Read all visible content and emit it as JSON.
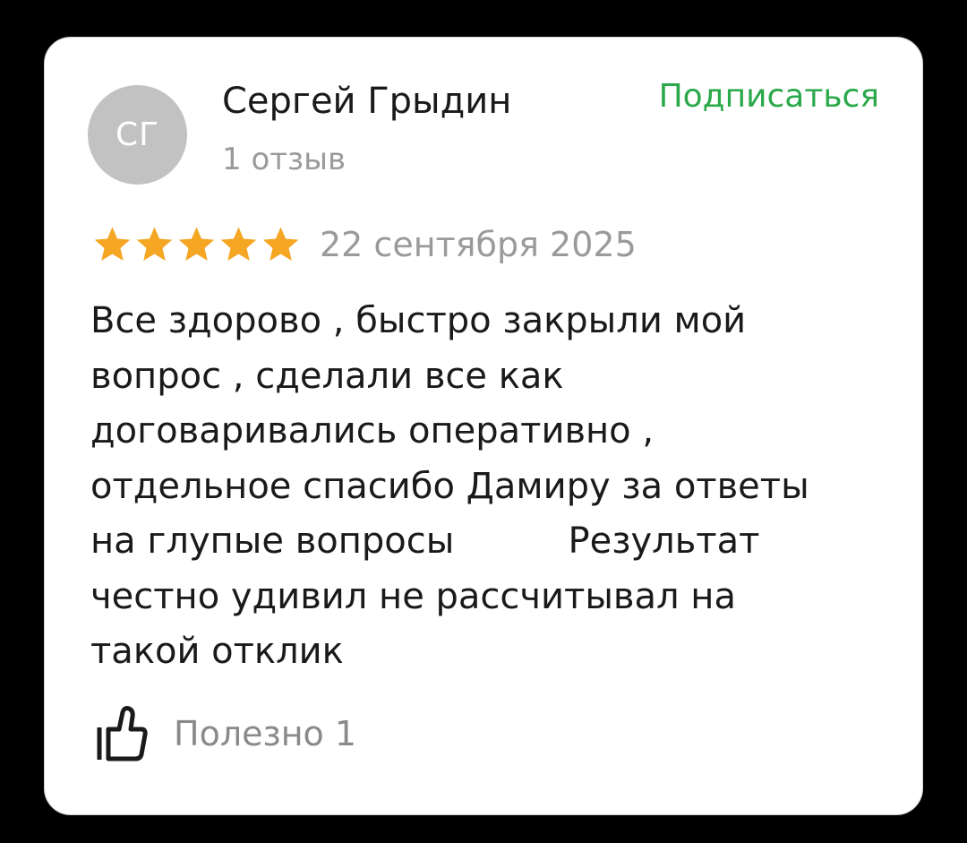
{
  "review": {
    "author": {
      "initials": "СГ",
      "name": "Сергей Грыдин",
      "review_count": "1 отзыв"
    },
    "subscribe_label": "Подписаться",
    "rating": 5,
    "date": "22 сентября 2025",
    "text_lines": [
      "Все здорово , быстро закрыли мой",
      "вопрос , сделали все как",
      "договаривались оперативно ,",
      "отдельное спасибо Дамиру за ответы",
      "на глупые вопросы          Результат",
      "честно удивил не рассчитывал на",
      "такой отклик"
    ],
    "helpful_label": "Полезно 1"
  },
  "icons": {
    "star": "star-icon",
    "thumb": "thumbs-up-icon"
  },
  "colors": {
    "background": "#000000",
    "card": "#ffffff",
    "accent_green": "#2aa84a",
    "star": "#f5a623",
    "avatar": "#c2c2c2",
    "muted_text": "#9a9a9a",
    "main_text": "#1a1a1a"
  }
}
